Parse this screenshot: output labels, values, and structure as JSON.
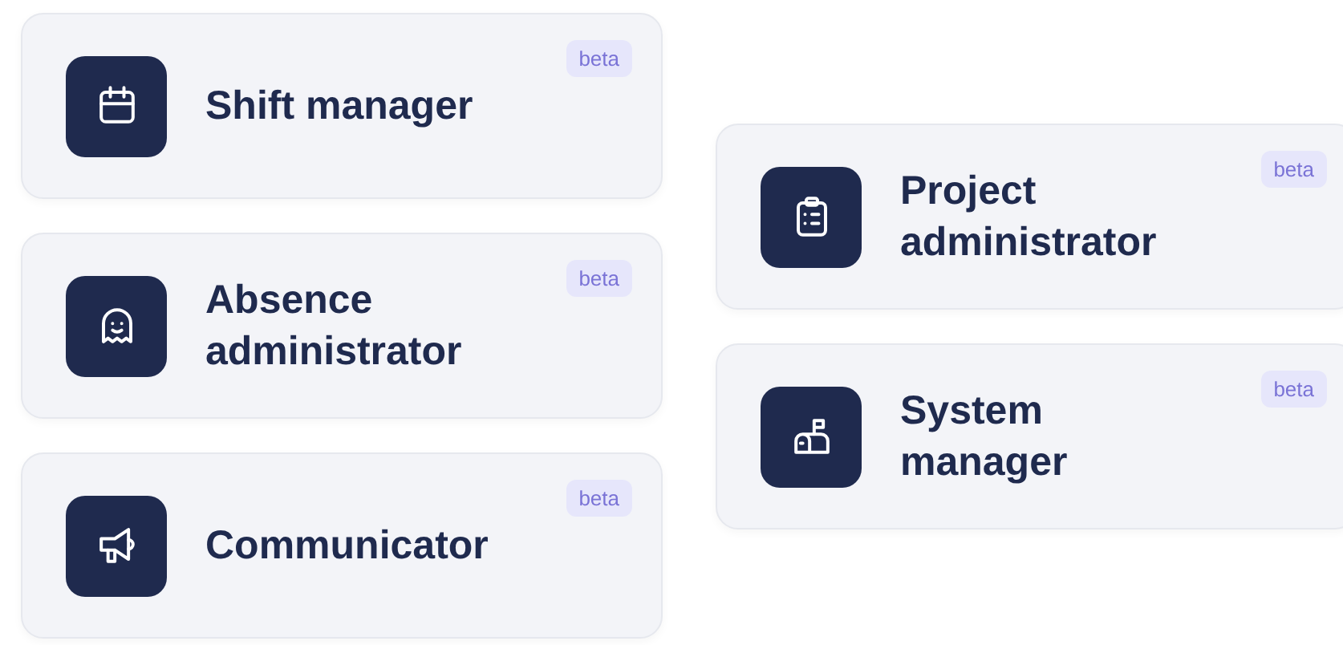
{
  "columns": [
    {
      "cards": [
        {
          "title": "Shift manager",
          "kind": "calendar",
          "badge": "beta"
        },
        {
          "title": "Absence administrator",
          "kind": "ghost",
          "badge": "beta"
        },
        {
          "title": "Communicator",
          "kind": "megaphone",
          "badge": "beta"
        }
      ]
    },
    {
      "cards": [
        {
          "title": "Project administrator",
          "kind": "clipboard",
          "badge": "beta"
        },
        {
          "title": "System manager",
          "kind": "mailbox",
          "badge": "beta"
        }
      ]
    }
  ]
}
